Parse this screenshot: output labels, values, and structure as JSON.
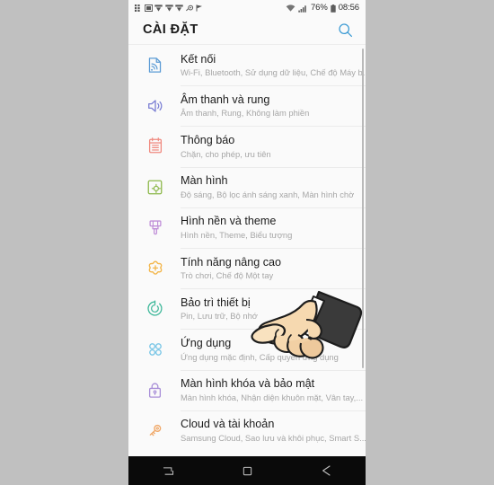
{
  "status_bar": {
    "notification_icons": [
      "apps-grid-icon",
      "image-icon",
      "download-icon",
      "download-icon",
      "download-icon",
      "settings-gear-icon",
      "flag-icon"
    ],
    "wifi_icon": "wifi-icon",
    "signal_icon": "cellular-signal-icon",
    "battery_percent": "76%",
    "battery_icon": "battery-icon",
    "clock": "08:56"
  },
  "app_bar": {
    "title": "CÀI ĐẶT",
    "search_icon": "search-icon",
    "accent_color": "#3c9bd4"
  },
  "settings": {
    "items": [
      {
        "icon": "connections-icon",
        "icon_color": "#5b9bd5",
        "title": "Kết nối",
        "subtitle": "Wi-Fi, Bluetooth, Sử dụng dữ liệu, Chế độ Máy b..."
      },
      {
        "icon": "sound-vibration-icon",
        "icon_color": "#7b7fd4",
        "title": "Âm thanh và rung",
        "subtitle": "Âm thanh, Rung, Không làm phiền"
      },
      {
        "icon": "notifications-icon",
        "icon_color": "#f08a80",
        "title": "Thông báo",
        "subtitle": "Chặn, cho phép, ưu tiên"
      },
      {
        "icon": "display-icon",
        "icon_color": "#8cb84a",
        "title": "Màn hình",
        "subtitle": "Độ sáng, Bộ lọc ánh sáng xanh, Màn hình chờ"
      },
      {
        "icon": "wallpaper-theme-icon",
        "icon_color": "#c08fd8",
        "title": "Hình nền và theme",
        "subtitle": "Hình nền, Theme, Biểu tượng"
      },
      {
        "icon": "advanced-features-icon",
        "icon_color": "#f3b64a",
        "title": "Tính năng nâng cao",
        "subtitle": "Trò chơi, Chế độ Một tay"
      },
      {
        "icon": "device-maintenance-icon",
        "icon_color": "#3fb89a",
        "title": "Bảo trì thiết bị",
        "subtitle": "Pin, Lưu trữ, Bộ nhớ"
      },
      {
        "icon": "applications-icon",
        "icon_color": "#79c6e6",
        "title": "Ứng dụng",
        "subtitle": "Ứng dụng mặc định, Cấp quyền ứng dụng"
      },
      {
        "icon": "lock-screen-security-icon",
        "icon_color": "#a98fd8",
        "title": "Màn hình khóa và bảo mật",
        "subtitle": "Màn hình khóa, Nhận diện khuôn mặt, Vân tay,..."
      },
      {
        "icon": "cloud-accounts-icon",
        "icon_color": "#f0a868",
        "title": "Cloud và tài khoản",
        "subtitle": "Samsung Cloud, Sao lưu và khôi phục, Smart S..."
      }
    ]
  },
  "nav_bar": {
    "recents_icon": "recents-icon",
    "home_icon": "home-icon",
    "back_icon": "back-icon"
  },
  "overlay": {
    "pointer": "pointing-hand-cursor"
  }
}
